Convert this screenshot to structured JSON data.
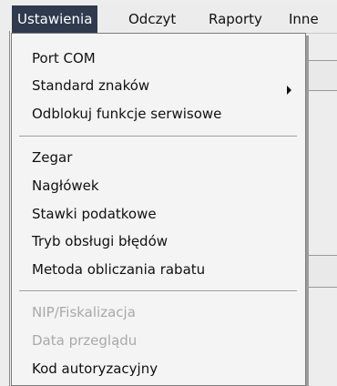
{
  "menubar": {
    "items": [
      {
        "label": "Ustawienia"
      },
      {
        "label": "Odczyt"
      },
      {
        "label": "Raporty"
      },
      {
        "label": "Inne"
      }
    ]
  },
  "dropdown": {
    "group1": [
      {
        "label": "Port COM"
      },
      {
        "label": "Standard znaków",
        "submenu_icon": "chevron-right-icon"
      },
      {
        "label": "Odblokuj funkcje serwisowe"
      }
    ],
    "group2": [
      {
        "label": "Zegar"
      },
      {
        "label": "Nagłówek"
      },
      {
        "label": "Stawki podatkowe"
      },
      {
        "label": "Tryb obsługi błędów"
      },
      {
        "label": "Metoda obliczania rabatu"
      }
    ],
    "group3": [
      {
        "label": "NIP/Fiskalizacja",
        "disabled": true
      },
      {
        "label": "Data przeglądu",
        "disabled": true
      },
      {
        "label": "Kod autoryzacyjny"
      }
    ]
  },
  "colors": {
    "menubar_active_bg": "#2f3a4f",
    "disabled_text": "#a9a9a9"
  }
}
